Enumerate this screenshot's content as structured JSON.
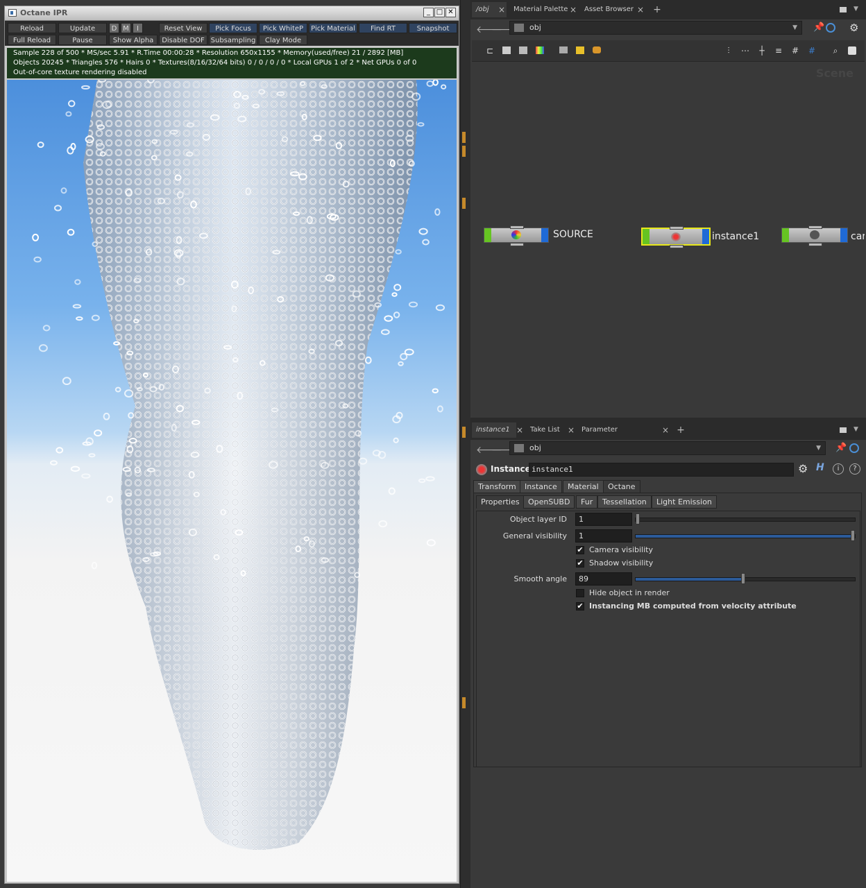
{
  "ipr": {
    "title": "Octane IPR",
    "win_min": "_",
    "win_max": "□",
    "win_close": "✕",
    "row1": [
      "Reload",
      "Update",
      "D",
      "M",
      "I",
      "Reset View",
      "Pick Focus",
      "Pick WhiteP",
      "Pick Material",
      "Find RT",
      "Snapshot"
    ],
    "row2": [
      "Full Reload",
      "Pause",
      "Show Alpha",
      "Disable DOF",
      "Subsampling",
      "Clay Mode"
    ],
    "stats": [
      "Sample 228 of 500 * MS/sec 5.91 * R.Time 00:00:28 * Resolution 650x1155 * Memory(used/free) 21 / 2892 [MB]",
      "Objects 20245 * Triangles 576 * Hairs 0 * Textures(8/16/32/64 bits) 0 / 0 / 0 / 0 * Local GPUs 1 of 2 * Net GPUs 0 of 0",
      "Out-of-core texture rendering disabled"
    ]
  },
  "network": {
    "tabs": [
      "/obj",
      "Material Palette",
      "Asset Browser"
    ],
    "tab_close": "×",
    "tab_add": "+",
    "path": "obj",
    "watermark": "Scene",
    "nodes": [
      {
        "label": "SOURCE"
      },
      {
        "label": "instance1"
      },
      {
        "label": "car"
      }
    ]
  },
  "parms": {
    "tabs": [
      "instance1",
      "Take List",
      "Parameter Spreadsheet"
    ],
    "tab_close": "×",
    "tab_add": "+",
    "path": "obj",
    "node_type": "Instance",
    "node_name": "instance1",
    "main_tabs": [
      "Transform",
      "Instance",
      "Material",
      "Octane"
    ],
    "sub_tabs": [
      "Properties",
      "OpenSUBD",
      "Fur",
      "Tessellation",
      "Light Emission"
    ],
    "fields": [
      {
        "label": "Object layer ID",
        "value": "1",
        "fraction": 0.0
      },
      {
        "label": "General visibility",
        "value": "1",
        "fraction": 1.0
      },
      {
        "label": "Smooth angle",
        "value": "89",
        "fraction": 0.49
      }
    ],
    "checks": [
      {
        "label": "Camera visibility",
        "checked": true
      },
      {
        "label": "Shadow visibility",
        "checked": true
      },
      {
        "label": "Hide object in render",
        "checked": false
      },
      {
        "label": "Instancing MB computed from velocity attribute",
        "checked": true
      }
    ],
    "check_mark": "✔"
  },
  "colors": {
    "node_input": "#66c422",
    "node_output": "#1f6ad6",
    "selected_node": "#e8e81a",
    "stats_bg": "#1c3a1c",
    "sky_top": "#4c8fdc"
  }
}
